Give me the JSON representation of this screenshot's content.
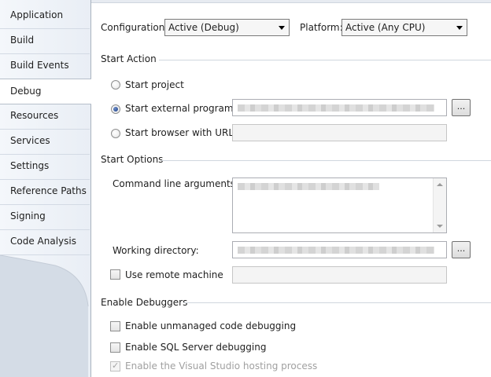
{
  "tabs": [
    {
      "label": "Application",
      "active": false
    },
    {
      "label": "Build",
      "active": false
    },
    {
      "label": "Build Events",
      "active": false
    },
    {
      "label": "Debug",
      "active": true
    },
    {
      "label": "Resources",
      "active": false
    },
    {
      "label": "Services",
      "active": false
    },
    {
      "label": "Settings",
      "active": false
    },
    {
      "label": "Reference Paths",
      "active": false
    },
    {
      "label": "Signing",
      "active": false
    },
    {
      "label": "Code Analysis",
      "active": false
    }
  ],
  "config": {
    "configuration_label": "Configuration:",
    "configuration_value": "Active (Debug)",
    "platform_label": "Platform:",
    "platform_value": "Active (Any CPU)"
  },
  "start_action": {
    "title": "Start Action",
    "start_project": "Start project",
    "start_external": "Start external program:",
    "start_browser": "Start browser with URL:",
    "selected": "start_external",
    "browse_label": "..."
  },
  "start_options": {
    "title": "Start Options",
    "command_line_label": "Command line arguments:",
    "working_dir_label": "Working directory:",
    "browse_label": "...",
    "remote_machine_label": "Use remote machine"
  },
  "debuggers": {
    "title": "Enable Debuggers",
    "unmanaged": "Enable unmanaged code debugging",
    "sql": "Enable SQL Server debugging",
    "hosting": "Enable the Visual Studio hosting process"
  }
}
